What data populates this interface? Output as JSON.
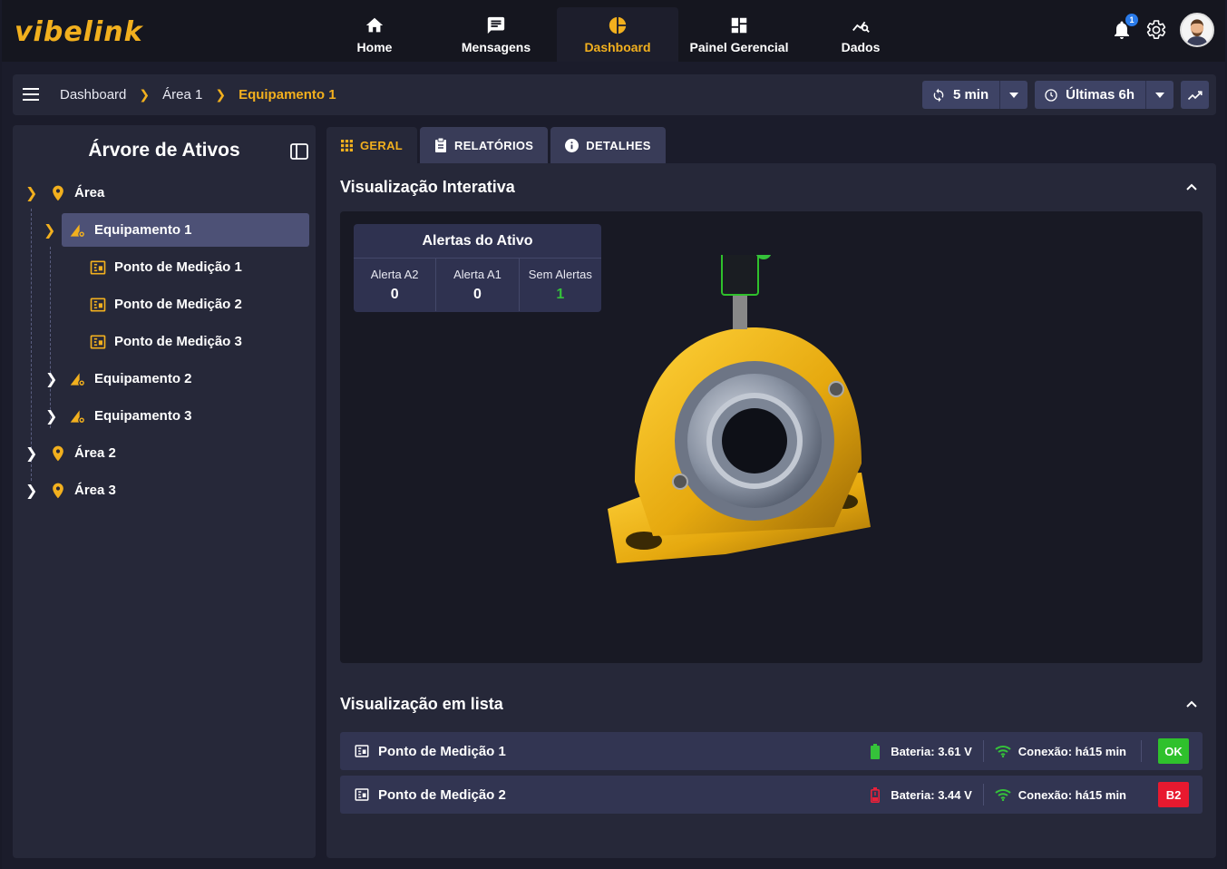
{
  "brand": {
    "logo_text": "vibelink",
    "accent": "#f2b01e"
  },
  "nav": {
    "items": [
      {
        "label": "Home",
        "icon": "home-icon"
      },
      {
        "label": "Mensagens",
        "icon": "message-icon"
      },
      {
        "label": "Dashboard",
        "icon": "pie-chart-icon",
        "active": true
      },
      {
        "label": "Painel Gerencial",
        "icon": "grid-icon"
      },
      {
        "label": "Dados",
        "icon": "data-analysis-icon"
      }
    ],
    "notifications_count": "1"
  },
  "breadcrumb": {
    "items": [
      "Dashboard",
      "Área 1"
    ],
    "current": "Equipamento 1"
  },
  "controls": {
    "refresh_label": "5 min",
    "range_label": "Últimas 6h"
  },
  "sidebar": {
    "title": "Árvore de Ativos",
    "tree": [
      {
        "label": "Área",
        "type": "area"
      },
      {
        "label": "Equipamento 1",
        "type": "equipment",
        "selected": true
      },
      {
        "label": "Ponto de Medição 1",
        "type": "point"
      },
      {
        "label": "Ponto de Medição 2",
        "type": "point"
      },
      {
        "label": "Ponto de Medição 3",
        "type": "point"
      },
      {
        "label": "Equipamento 2",
        "type": "equipment"
      },
      {
        "label": "Equipamento 3",
        "type": "equipment"
      },
      {
        "label": "Área 2",
        "type": "area"
      },
      {
        "label": "Área 3",
        "type": "area"
      }
    ]
  },
  "tabs": [
    {
      "label": "GERAL",
      "icon": "grid-dots-icon",
      "active": true
    },
    {
      "label": "RELATÓRIOS",
      "icon": "clipboard-icon"
    },
    {
      "label": "DETALHES",
      "icon": "info-icon"
    }
  ],
  "interactive": {
    "title": "Visualização Interativa",
    "alerts": {
      "title": "Alertas do Ativo",
      "columns": [
        {
          "label": "Alerta A2",
          "value": "0"
        },
        {
          "label": "Alerta A1",
          "value": "0"
        },
        {
          "label": "Sem Alertas",
          "value": "1"
        }
      ]
    }
  },
  "list": {
    "title": "Visualização em lista",
    "rows": [
      {
        "label": "Ponto de Medição 1",
        "battery": "Bateria: 3.61 V",
        "battery_color": "#35c23a",
        "connection": "Conexão: há15 min",
        "status": "OK",
        "status_color": "#2fc12c"
      },
      {
        "label": "Ponto de Medição 2",
        "battery": "Bateria: 3.44 V",
        "battery_color": "#e8213a",
        "connection": "Conexão: há15 min",
        "status": "B2",
        "status_color": "#e8192f"
      }
    ]
  }
}
